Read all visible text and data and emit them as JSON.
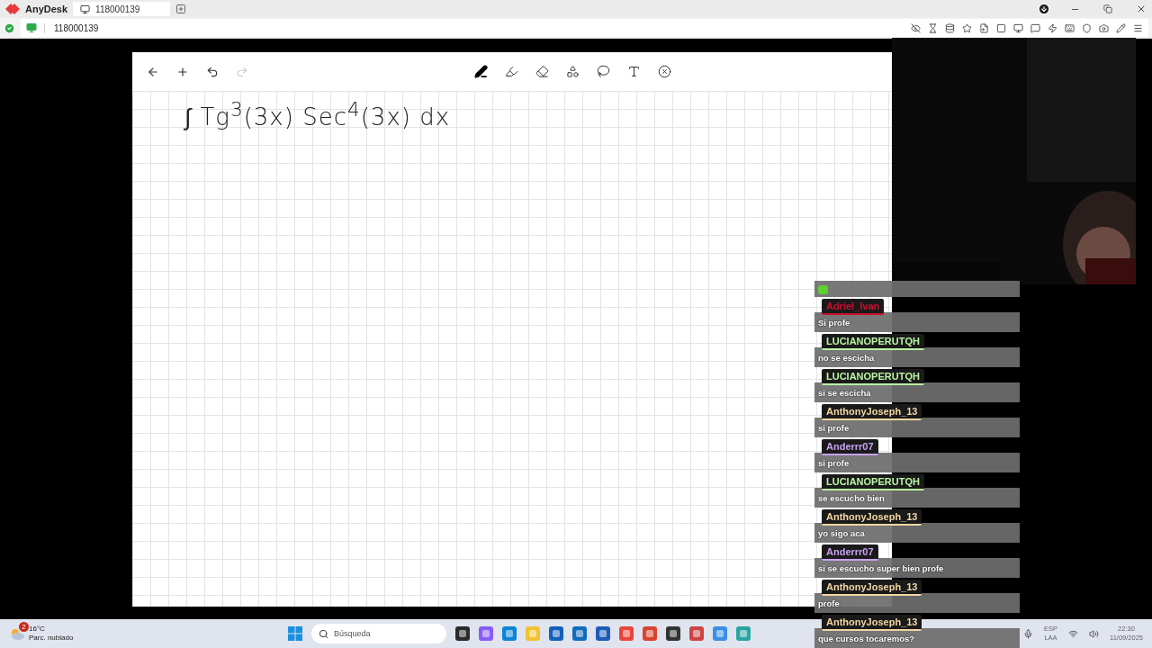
{
  "app": {
    "name": "AnyDesk",
    "tab": {
      "label": "118000139"
    }
  },
  "address": {
    "value": "118000139"
  },
  "board": {
    "actions": [
      {
        "kind": "back",
        "disabled": false
      },
      {
        "kind": "add",
        "disabled": false
      },
      {
        "kind": "undo",
        "disabled": false
      },
      {
        "kind": "redo",
        "disabled": true
      }
    ],
    "tools": [
      {
        "kind": "pen",
        "selected": true
      },
      {
        "kind": "marker",
        "selected": false
      },
      {
        "kind": "eraser",
        "selected": false
      },
      {
        "kind": "shapes",
        "selected": false
      },
      {
        "kind": "lasso",
        "selected": false
      },
      {
        "kind": "text",
        "selected": false
      },
      {
        "kind": "close",
        "selected": false
      }
    ],
    "expression": "∫ Tg$^{3}$(3x) Sec$^{4}$(3x) dx"
  },
  "chat": {
    "messages": [
      {
        "kind": "emote"
      },
      {
        "kind": "text",
        "user": "Adriel_Ivan",
        "color": "#c8102e",
        "text": "Si profe"
      },
      {
        "kind": "text",
        "user": "LUCIANOPERUTQH",
        "color": "#b9f5a2",
        "text": "no se escicha"
      },
      {
        "kind": "text",
        "user": "LUCIANOPERUTQH",
        "color": "#b9f5a2",
        "text": "si se escicha"
      },
      {
        "kind": "text",
        "user": "AnthonyJoseph_13",
        "color": "#f2d6a2",
        "text": "si profe"
      },
      {
        "kind": "text",
        "user": "Anderrr07",
        "color": "#c8a2f0",
        "text": "si profe"
      },
      {
        "kind": "text",
        "user": "LUCIANOPERUTQH",
        "color": "#b9f5a2",
        "text": "se escucho bien"
      },
      {
        "kind": "text",
        "user": "AnthonyJoseph_13",
        "color": "#f2d6a2",
        "text": "yo sigo aca"
      },
      {
        "kind": "text",
        "user": "Anderrr07",
        "color": "#c8a2f0",
        "text": "si se escucho super bien profe"
      },
      {
        "kind": "text",
        "user": "AnthonyJoseph_13",
        "color": "#f2d6a2",
        "text": "profe"
      },
      {
        "kind": "text",
        "user": "AnthonyJoseph_13",
        "color": "#f2d6a2",
        "text": "que cursos tocaremos?"
      }
    ]
  },
  "taskbar": {
    "weather": {
      "badge": "2",
      "temperature": "16°C",
      "condition": "Parc. nublado"
    },
    "search": {
      "placeholder": "Búsqueda"
    },
    "tray": {
      "language": "ESP",
      "layout": "LAA",
      "time": "22:30",
      "date": "11/09/2025"
    }
  }
}
